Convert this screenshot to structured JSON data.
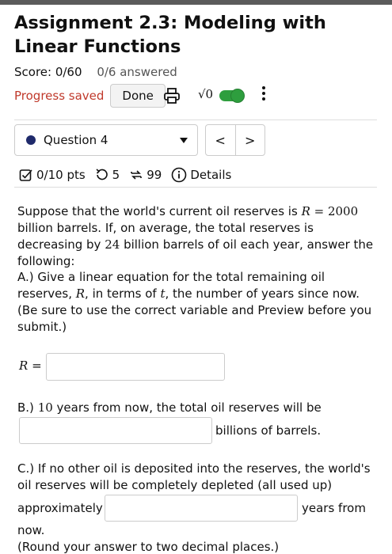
{
  "header": {
    "title": "Assignment 2.3: Modeling with Linear Functions",
    "score": "Score: 0/60",
    "answered": "0/6 answered",
    "progress_saved": "Progress saved",
    "done_label": "Done",
    "sqrt_label": "√0"
  },
  "question_nav": {
    "current": "Question 4",
    "prev": "<",
    "next": ">"
  },
  "meta": {
    "points": "0/10 pts",
    "attempts": "5",
    "versions": "99",
    "details": "Details"
  },
  "question": {
    "intro_1": "Suppose that the world's current oil reserves is ",
    "intro_R": "R",
    "intro_eq": " = 2000",
    "intro_2": " billion barrels. If, on average, the total reserves is decreasing by ",
    "intro_24": "24",
    "intro_3": " billion barrels of oil each year, answer the following:",
    "a_1": "A.) Give a linear equation for the total remaining oil reserves, ",
    "a_R": "R",
    "a_2": ", in terms of ",
    "a_t": "t",
    "a_3": ",  the number of years since now. (Be sure to use the correct variable and Preview before you submit.)",
    "r_label_var": "R",
    "r_label_eq": " =",
    "b_1": "B.) ",
    "b_10": "10",
    "b_2": " years from now, the total oil reserves will be",
    "b_suffix": "billions of barrels.",
    "c_text": "C.) If no other oil is deposited into the reserves, the world's oil reserves will be completely depleted (all used up)",
    "c_approx": "approximately",
    "c_suffix": "years from",
    "c_now": "now.",
    "c_round": "(Round your answer to two decimal places.)"
  },
  "inputs": {
    "r_value": "",
    "b_value": "",
    "c_value": ""
  },
  "colors": {
    "progress_saved": "#c0392b",
    "toggle": "#2e9e3e",
    "question_dot": "#1f2a6b",
    "top_bar": "#5b5b5b"
  },
  "icons": [
    "print-icon",
    "kebab-menu-icon",
    "checkbox-edit-icon",
    "retry-icon",
    "versions-icon",
    "info-icon",
    "chevron-down-icon"
  ]
}
